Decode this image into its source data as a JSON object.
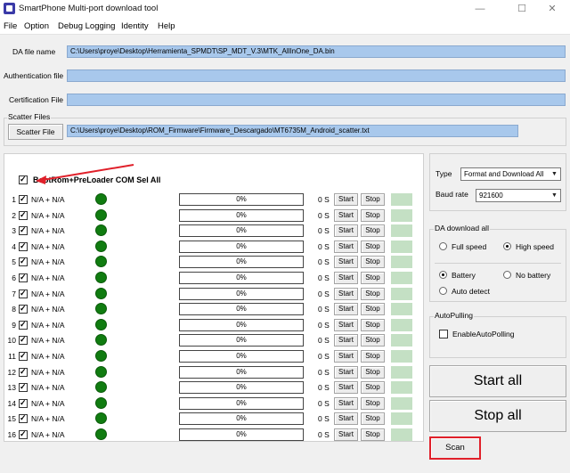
{
  "window": {
    "title": "SmartPhone Multi-port download tool",
    "minimize": "—",
    "maximize": "☐",
    "close": "✕"
  },
  "menu": [
    "File",
    "Option",
    "Debug Logging",
    "Identity",
    "Help"
  ],
  "files": {
    "da_label": "DA file name",
    "da_value": "C:\\Users\\proye\\Desktop\\Herramienta_SPMDT\\SP_MDT_V.3\\MTK_AllInOne_DA.bin",
    "auth_label": "Authentication file",
    "auth_value": "",
    "cert_label": "Certification File",
    "cert_value": "",
    "scatter_group": "Scatter Files",
    "scatter_button": "Scatter File",
    "scatter_value": "C:\\Users\\proye\\Desktop\\ROM_Firmware\\Firmware_Descargado\\MT6735M_Android_scatter.txt"
  },
  "ports": {
    "select_all_label": "BootRom+PreLoader COM Sel All",
    "select_all_checked": true,
    "start_label": "Start",
    "stop_label": "Stop",
    "rows": [
      {
        "num": "1",
        "port": "N/A + N/A",
        "progress": "0%",
        "size": "0 S",
        "checked": true,
        "led": "#107c10"
      },
      {
        "num": "2",
        "port": "N/A + N/A",
        "progress": "0%",
        "size": "0 S",
        "checked": true,
        "led": "#107c10"
      },
      {
        "num": "3",
        "port": "N/A + N/A",
        "progress": "0%",
        "size": "0 S",
        "checked": true,
        "led": "#107c10"
      },
      {
        "num": "4",
        "port": "N/A + N/A",
        "progress": "0%",
        "size": "0 S",
        "checked": true,
        "led": "#107c10"
      },
      {
        "num": "5",
        "port": "N/A + N/A",
        "progress": "0%",
        "size": "0 S",
        "checked": true,
        "led": "#107c10"
      },
      {
        "num": "6",
        "port": "N/A + N/A",
        "progress": "0%",
        "size": "0 S",
        "checked": true,
        "led": "#107c10"
      },
      {
        "num": "7",
        "port": "N/A + N/A",
        "progress": "0%",
        "size": "0 S",
        "checked": true,
        "led": "#107c10"
      },
      {
        "num": "8",
        "port": "N/A + N/A",
        "progress": "0%",
        "size": "0 S",
        "checked": true,
        "led": "#107c10"
      },
      {
        "num": "9",
        "port": "N/A + N/A",
        "progress": "0%",
        "size": "0 S",
        "checked": true,
        "led": "#107c10"
      },
      {
        "num": "10",
        "port": "N/A + N/A",
        "progress": "0%",
        "size": "0 S",
        "checked": true,
        "led": "#107c10"
      },
      {
        "num": "11",
        "port": "N/A + N/A",
        "progress": "0%",
        "size": "0 S",
        "checked": true,
        "led": "#107c10"
      },
      {
        "num": "12",
        "port": "N/A + N/A",
        "progress": "0%",
        "size": "0 S",
        "checked": true,
        "led": "#107c10"
      },
      {
        "num": "13",
        "port": "N/A + N/A",
        "progress": "0%",
        "size": "0 S",
        "checked": true,
        "led": "#107c10"
      },
      {
        "num": "14",
        "port": "N/A + N/A",
        "progress": "0%",
        "size": "0 S",
        "checked": true,
        "led": "#107c10"
      },
      {
        "num": "15",
        "port": "N/A + N/A",
        "progress": "0%",
        "size": "0 S",
        "checked": true,
        "led": "#107c10"
      },
      {
        "num": "16",
        "port": "N/A + N/A",
        "progress": "0%",
        "size": "0 S",
        "checked": true,
        "led": "#107c10"
      }
    ]
  },
  "settings": {
    "type_label": "Type",
    "type_value": "Format and Download All",
    "baud_label": "Baud rate",
    "baud_value": "921600",
    "da_all_group": "DA download all",
    "full_speed": "Full speed",
    "high_speed": "High speed",
    "speed_selected": "High speed",
    "battery": "Battery",
    "no_battery": "No battery",
    "auto_detect": "Auto detect",
    "battery_selected": "Battery",
    "autopolling_group": "AutoPulling",
    "enable_autopolling": "EnableAutoPolling",
    "autopolling_checked": false,
    "start_all": "Start all",
    "stop_all": "Stop all",
    "scan": "Scan"
  },
  "colors": {
    "highlight": "#e0202a",
    "led_green": "#107c10",
    "field_blue": "#a8c8ec",
    "status_green": "#c4e0c4"
  }
}
